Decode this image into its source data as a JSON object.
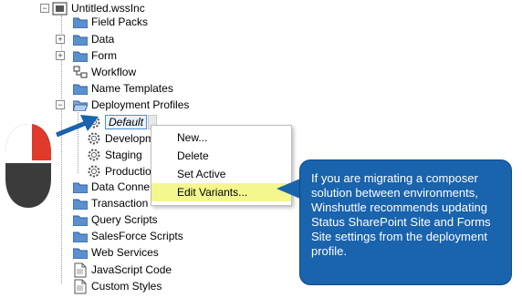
{
  "tree": {
    "root": "Untitled.wssInc",
    "items": [
      {
        "label": "Field Packs",
        "icon": "folder-icon"
      },
      {
        "label": "Data",
        "icon": "folder-icon"
      },
      {
        "label": "Form",
        "icon": "folder-icon"
      },
      {
        "label": "Workflow",
        "icon": "workflow-icon"
      },
      {
        "label": "Name Templates",
        "icon": "folder-icon"
      },
      {
        "label": "Deployment Profiles",
        "icon": "open-folder-icon"
      },
      {
        "label": "Default",
        "icon": "gear-icon"
      },
      {
        "label": "Developm",
        "icon": "gear-icon"
      },
      {
        "label": "Staging",
        "icon": "gear-icon"
      },
      {
        "label": "Productio",
        "icon": "gear-icon"
      },
      {
        "label": "Data Conne",
        "icon": "folder-icon"
      },
      {
        "label": "Transaction",
        "icon": "folder-icon"
      },
      {
        "label": "Query Scripts",
        "icon": "folder-icon"
      },
      {
        "label": "SalesForce Scripts",
        "icon": "folder-icon"
      },
      {
        "label": "Web Services",
        "icon": "folder-icon"
      },
      {
        "label": "JavaScript Code",
        "icon": "document-icon"
      },
      {
        "label": "Custom Styles",
        "icon": "document-icon"
      }
    ]
  },
  "context_menu": {
    "items": [
      "New...",
      "Delete",
      "Set Active",
      "Edit Variants..."
    ],
    "highlighted": "Edit Variants..."
  },
  "callout": {
    "text": "If you are migrating a composer solution between environments, Winshuttle recommends updating Status SharePoint Site and Forms Site settings from the deployment profile."
  },
  "colors": {
    "callout_bg": "#1a63ad",
    "arrow": "#1a63ad",
    "highlight": "#f4f78d",
    "mouse_body": "#3b3b3b",
    "mouse_button": "#e03a2a"
  }
}
